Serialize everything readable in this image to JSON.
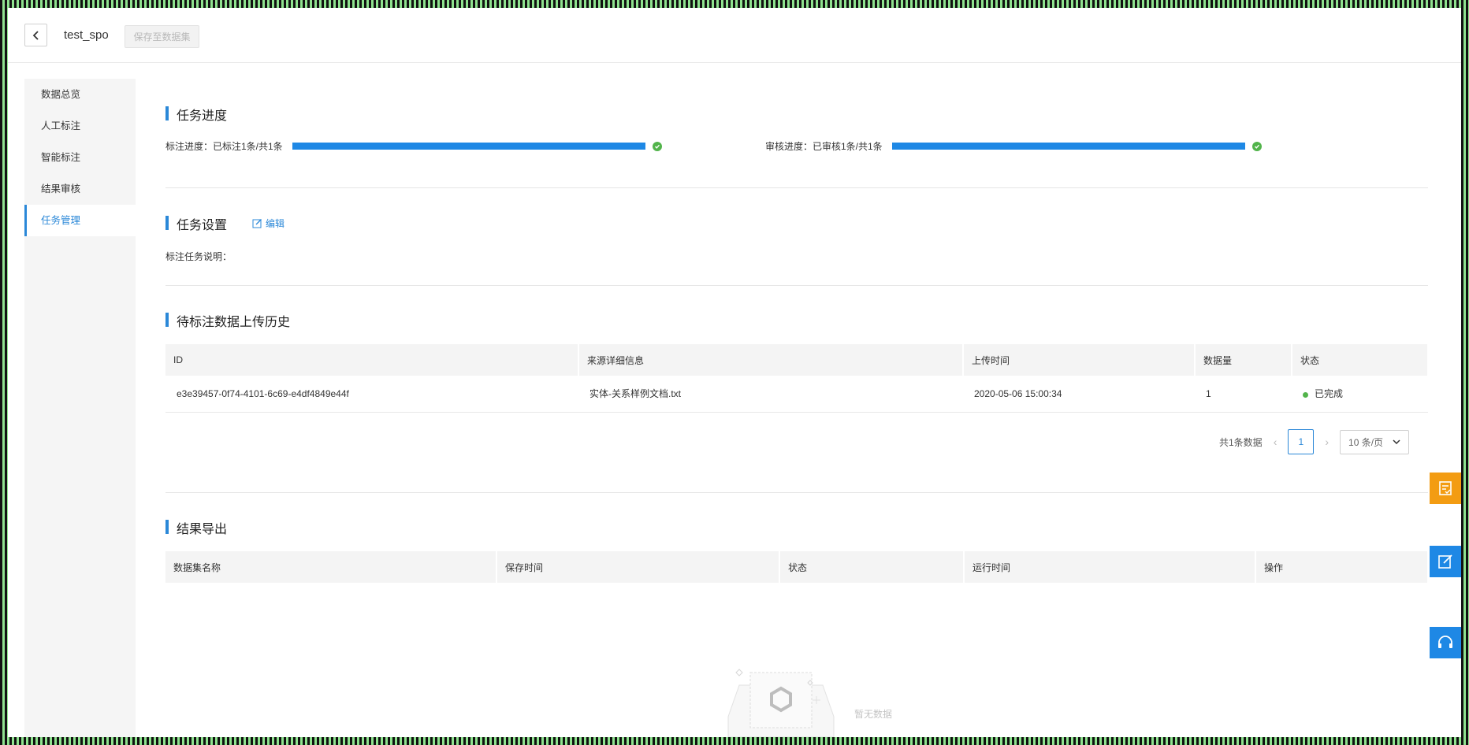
{
  "header": {
    "title": "test_spo",
    "save_label": "保存至数据集"
  },
  "sidebar": {
    "items": [
      {
        "label": "数据总览"
      },
      {
        "label": "人工标注"
      },
      {
        "label": "智能标注"
      },
      {
        "label": "结果审核"
      },
      {
        "label": "任务管理"
      }
    ],
    "active_index": 4
  },
  "progress": {
    "title": "任务进度",
    "label_progress": {
      "label": "标注进度：已标注1条/共1条",
      "fraction": 1.0
    },
    "review_progress": {
      "label": "审核进度：已审核1条/共1条",
      "fraction": 1.0
    }
  },
  "settings": {
    "title": "任务设置",
    "edit_label": "编辑",
    "description_label": "标注任务说明："
  },
  "upload_history": {
    "title": "待标注数据上传历史",
    "columns": [
      "ID",
      "来源详细信息",
      "上传时间",
      "数据量",
      "状态"
    ],
    "rows": [
      {
        "id": "e3e39457-0f74-4101-6c69-e4df4849e44f",
        "source": "实体-关系样例文档.txt",
        "time": "2020-05-06 15:00:34",
        "count": "1",
        "status": "已完成"
      }
    ],
    "pager": {
      "total_text": "共1条数据",
      "current_page": "1",
      "page_size": "10 条/页"
    }
  },
  "export": {
    "title": "结果导出",
    "columns": [
      "数据集名称",
      "保存时间",
      "状态",
      "运行时间",
      "操作"
    ],
    "empty_text": "暂无数据"
  },
  "colors": {
    "accent": "#2b88d8",
    "progress": "#1e88e5",
    "success": "#52b44b",
    "float_orange": "#f39c12",
    "float_blue": "#1e88e5"
  },
  "float_buttons": [
    "feedback-icon",
    "edit-note-icon",
    "headset-icon"
  ]
}
